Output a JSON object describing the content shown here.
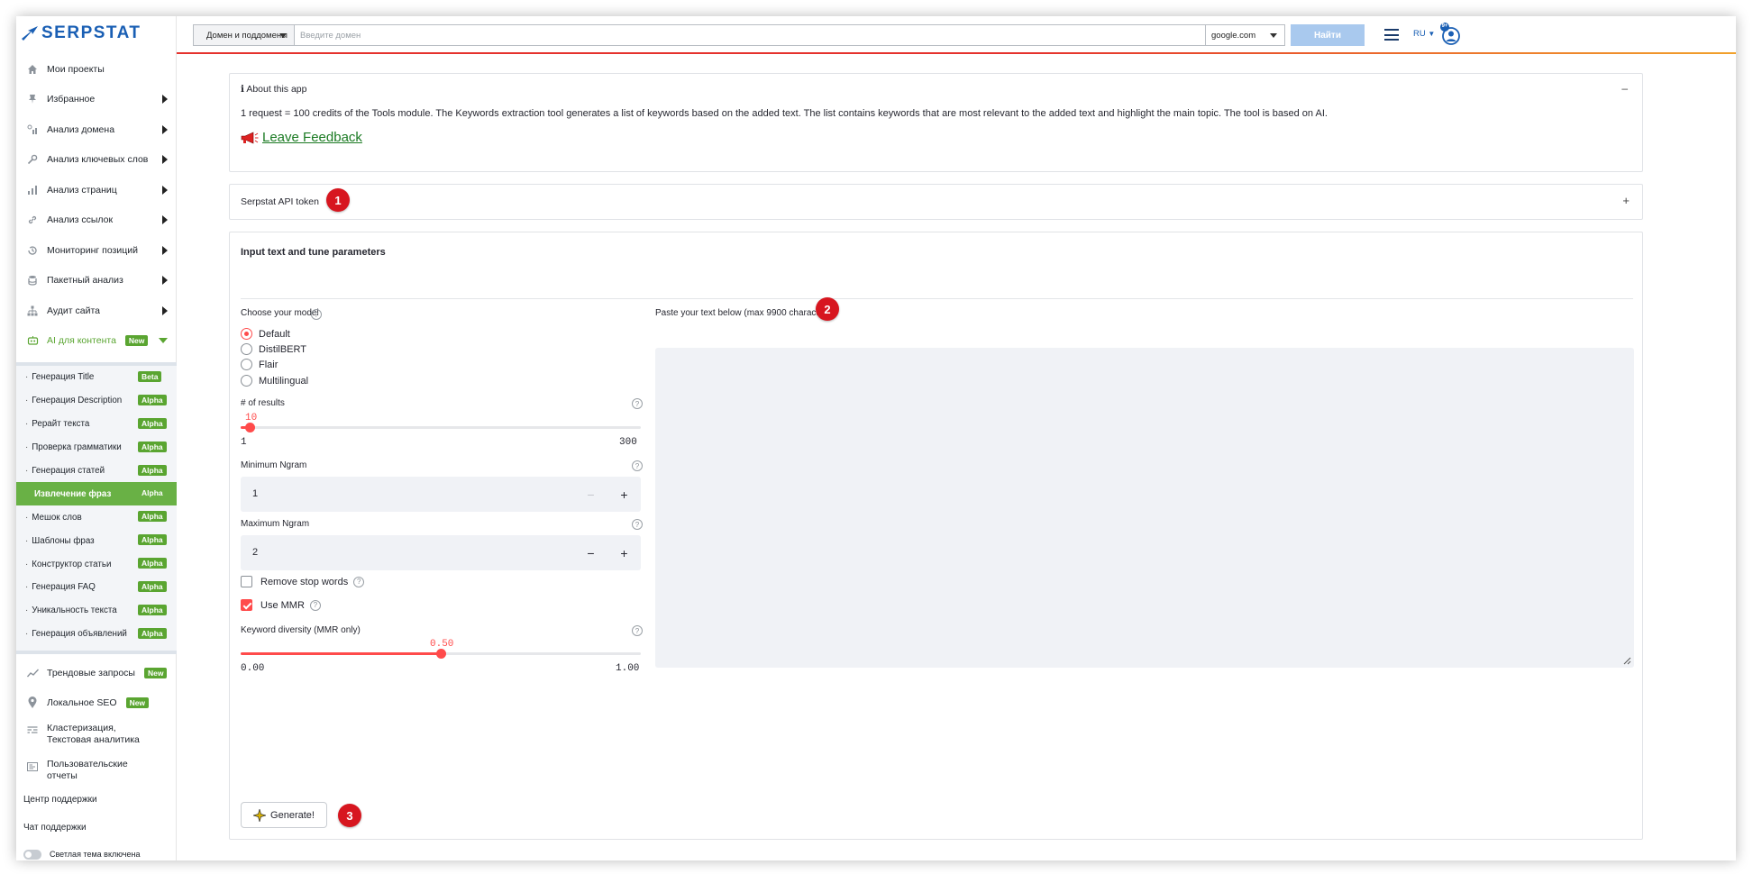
{
  "brand": {
    "name": "SERPSTAT"
  },
  "topbar": {
    "scope_dropdown": "Домен и поддомены",
    "search_placeholder": "Введите домен",
    "engine_dropdown": "google.com",
    "find_button": "Найти",
    "language": "RU",
    "user_badge": "9+"
  },
  "sidebar": {
    "items": [
      {
        "label": "Мои проекты",
        "icon": "home-icon"
      },
      {
        "label": "Избранное",
        "icon": "pin-icon"
      },
      {
        "label": "Анализ домена",
        "icon": "domain-analysis-icon"
      },
      {
        "label": "Анализ ключевых слов",
        "icon": "key-icon"
      },
      {
        "label": "Анализ страниц",
        "icon": "bar-chart-icon"
      },
      {
        "label": "Анализ ссылок",
        "icon": "link-icon"
      },
      {
        "label": "Мониторинг позиций",
        "icon": "history-icon"
      },
      {
        "label": "Пакетный анализ",
        "icon": "database-icon"
      },
      {
        "label": "Аудит сайта",
        "icon": "sitemap-icon"
      },
      {
        "label": "AI для контента",
        "icon": "robot-icon",
        "badge": "New"
      }
    ],
    "sub_items": [
      {
        "label": "Генерация Title",
        "badge": "Beta"
      },
      {
        "label": "Генерация Description",
        "badge": "Alpha"
      },
      {
        "label": "Рерайт текста",
        "badge": "Alpha"
      },
      {
        "label": "Проверка грамматики",
        "badge": "Alpha"
      },
      {
        "label": "Генерация статей",
        "badge": "Alpha"
      },
      {
        "label": "Извлечение фраз",
        "badge": "Alpha"
      },
      {
        "label": "Мешок слов",
        "badge": "Alpha"
      },
      {
        "label": "Шаблоны фраз",
        "badge": "Alpha"
      },
      {
        "label": "Конструктор статьи",
        "badge": "Alpha"
      },
      {
        "label": "Генерация FAQ",
        "badge": "Alpha"
      },
      {
        "label": "Уникальность текста",
        "badge": "Alpha"
      },
      {
        "label": "Генерация объявлений",
        "badge": "Alpha"
      }
    ],
    "bottom_items": [
      {
        "label": "Трендовые запросы",
        "badge": "New"
      },
      {
        "label": "Локальное SEO",
        "badge": "New"
      },
      {
        "label": "Кластеризация, Текстовая аналитика"
      },
      {
        "label": "Пользовательские отчеты"
      }
    ],
    "support_center": "Центр поддержки",
    "support_chat": "Чат поддержки",
    "theme_toggle": "Светлая тема включена"
  },
  "about": {
    "title": "ℹ About this app",
    "collapse_sign": "–",
    "description": "1 request = 100 credits of the Tools module. The Keywords extraction tool generates a list of keywords based on the added text. The list contains keywords that are most relevant to the added text and highlight the main topic. The tool is based on AI.",
    "feedback_link": "Leave Feedback"
  },
  "api_token": {
    "title": "Serpstat API token",
    "expand_sign": "+"
  },
  "callouts": [
    "1",
    "2",
    "3"
  ],
  "form": {
    "title": "Input text and tune parameters",
    "model_label": "Choose your model",
    "models": [
      "Default",
      "DistilBERT",
      "Flair",
      "Multilingual"
    ],
    "selected_model": "Default",
    "results_label": "# of results",
    "results_value": "10",
    "results_min": "1",
    "results_max": "300",
    "min_ngram_label": "Minimum Ngram",
    "min_ngram_value": "1",
    "max_ngram_label": "Maximum Ngram",
    "max_ngram_value": "2",
    "remove_stop_words": {
      "label": "Remove stop words",
      "checked": false
    },
    "use_mmr": {
      "label": "Use MMR",
      "checked": true
    },
    "diversity_label": "Keyword diversity (MMR only)",
    "diversity_value": "0.50",
    "diversity_min": "0.00",
    "diversity_max": "1.00",
    "text_label": "Paste your text below (max 9900 characters)",
    "generate_button": "Generate!",
    "minus": "−",
    "plus": "+",
    "help_glyph": "?"
  },
  "colors": {
    "accent": "#ff4b4b",
    "brand": "#1a5fb4",
    "badge_green": "#5aa531",
    "callout_red": "#d7161f"
  }
}
